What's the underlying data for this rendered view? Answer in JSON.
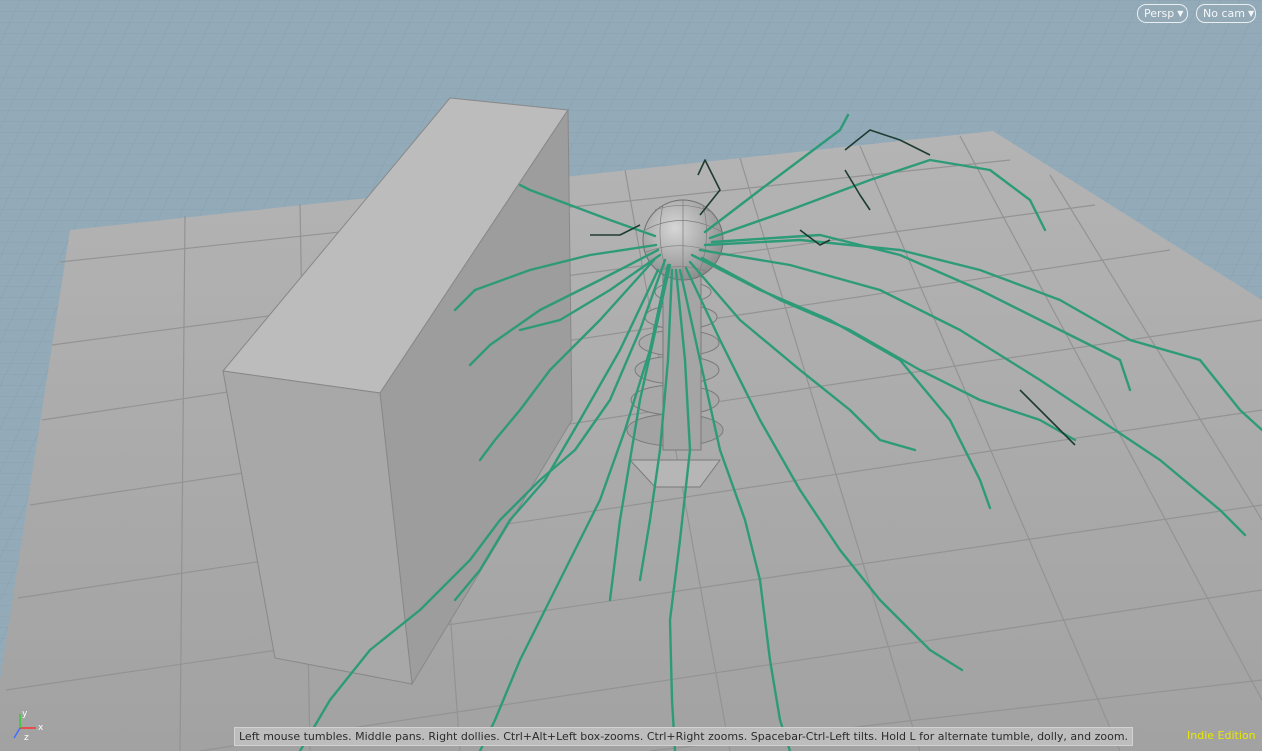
{
  "viewport": {
    "camera_menu": {
      "label": "Persp"
    },
    "cam_menu": {
      "label": "No cam"
    },
    "status_text": "Left mouse tumbles. Middle pans. Right dollies. Ctrl+Alt+Left box-zooms. Ctrl+Right zooms. Spacebar-Ctrl-Left tilts. Hold L for alternate tumble, dolly, and zoom.",
    "edition_label": "Indie Edition",
    "axis_labels": {
      "x": "x",
      "y": "y",
      "z": "z"
    }
  },
  "colors": {
    "background": "#93aab8",
    "grid_line": "#7f98a8",
    "floor": "#a9a9a9",
    "floor_line": "#8e8e8e",
    "wall_front": "#a6a6a6",
    "wall_top": "#bababa",
    "wall_side": "#9a9a9a",
    "branch": "#2e9b78",
    "branch_dark": "#1e3b30",
    "edition_text": "#e8e800"
  },
  "icons": [
    "axis-gizmo-icon",
    "chevron-down-icon"
  ]
}
